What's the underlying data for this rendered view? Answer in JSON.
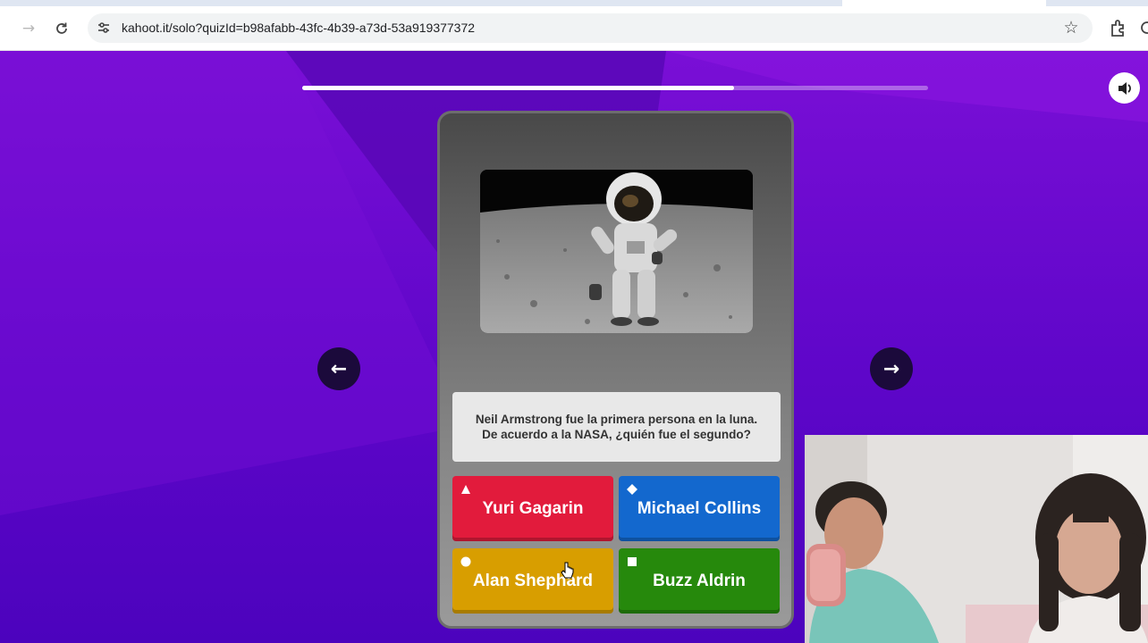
{
  "browser": {
    "url": "kahoot.it/solo?quizId=b98afabb-43fc-4b39-a73d-53a919377372",
    "icons": [
      "forward-arrow-icon",
      "reload-icon",
      "site-info-icon",
      "star-icon",
      "extensions-icon"
    ]
  },
  "quiz": {
    "progress_fraction": 0.69,
    "question": "Neil Armstrong fue la primera persona en la luna. De acuerdo a la NASA, ¿quién fue el segundo?",
    "answers": [
      {
        "label": "Yuri Gagarin",
        "shape": "triangle",
        "color": "#e21b3c"
      },
      {
        "label": "Michael Collins",
        "shape": "diamond",
        "color": "#1368ce"
      },
      {
        "label": "Alan Shephard",
        "shape": "circle",
        "color": "#d89e00"
      },
      {
        "label": "Buzz Aldrin",
        "shape": "square",
        "color": "#26890c"
      }
    ],
    "colors": {
      "background": "#6a08cc",
      "card": "#6c6c6c",
      "nav_button": "#1b0a3b"
    }
  }
}
